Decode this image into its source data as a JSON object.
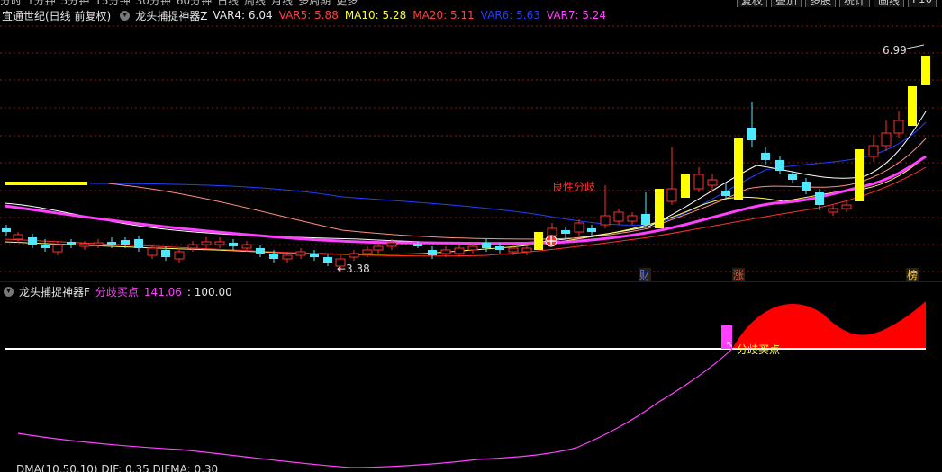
{
  "top_tabs": [
    "分时",
    "1分钟",
    "5分钟",
    "15分钟",
    "30分钟",
    "60分钟",
    "日线",
    "周线",
    "月线",
    "多周期",
    "更多"
  ],
  "top_right_buttons": [
    "复权",
    "叠加",
    "多股",
    "统计",
    "画线",
    "F10",
    "标"
  ],
  "legend": {
    "stock_title": "宜通世纪(日线 前复权)",
    "indicator_name": "龙头捕捉神器Z",
    "items": [
      {
        "label": "VAR4: 6.04",
        "color": "#e8e8e8"
      },
      {
        "label": "VAR5: 5.88",
        "color": "#ff4040"
      },
      {
        "label": "MA10: 5.28",
        "color": "#ffff40"
      },
      {
        "label": "MA20: 5.11",
        "color": "#ff4040"
      },
      {
        "label": "VAR6: 5.63",
        "color": "#2040ff"
      },
      {
        "label": "VAR7: 5.24",
        "color": "#ff40ff"
      }
    ]
  },
  "main_chart": {
    "price_high_label": "6.99",
    "price_low_label": "3.38",
    "annotation": "良性分歧",
    "event_markers": [
      "财",
      "涨",
      "榜"
    ],
    "colors": {
      "up": "#ff3030",
      "down": "#50e8ff",
      "signal": "#ffff00",
      "ma_magenta": "#ff40ff",
      "ma_blue": "#2040ff",
      "ma_yellow": "#ffff60",
      "ma_red": "#ff3030",
      "ma_white": "#ffffff"
    }
  },
  "indicator": {
    "name": "龙头捕捉神器F",
    "label": "分歧买点",
    "value_a": "141.06",
    "value_b": ": 100.00",
    "buy_label": "分歧买点",
    "colors": {
      "label": "#ff40ff",
      "fill": "#ff0000",
      "bar": "#ff40ff",
      "baseline": "#ffffff",
      "line": "#ff40ff"
    }
  },
  "bottom_row": "DMA(10,50,10) DIF: 0.35 DIFMA: 0.30"
}
